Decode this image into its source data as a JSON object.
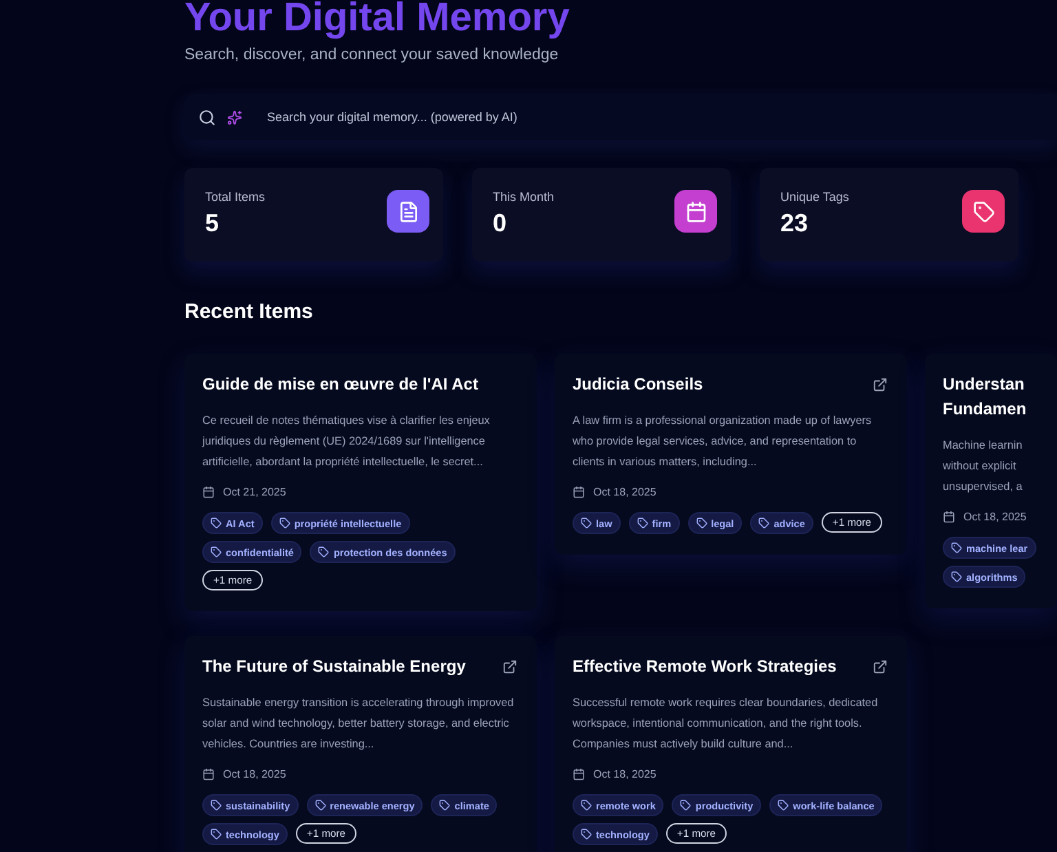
{
  "header": {
    "title": "Your Digital Memory",
    "subtitle": "Search, discover, and connect your saved knowledge"
  },
  "search": {
    "placeholder": "Search your digital memory... (powered by AI)"
  },
  "stats": [
    {
      "label": "Total Items",
      "value": "5",
      "color": "#7b5cf5"
    },
    {
      "label": "This Month",
      "value": "0",
      "color": "#c43fd0"
    },
    {
      "label": "Unique Tags",
      "value": "23",
      "color": "#ea3470"
    }
  ],
  "recent": {
    "heading": "Recent Items",
    "items": [
      {
        "title": "Guide de mise en œuvre de l'AI Act",
        "has_link": false,
        "description": "Ce recueil de notes thématiques vise à clarifier les enjeux juridiques du règlement (UE) 2024/1689 sur l'intelligence artificielle, abordant la propriété intellectuelle, le secret...",
        "date": "Oct 21, 2025",
        "tags": [
          "AI Act",
          "propriété intellectuelle",
          "confidentialité",
          "protection des données"
        ],
        "more": "+1 more"
      },
      {
        "title": "Judicia Conseils",
        "has_link": true,
        "description": "A law firm is a professional organization made up of lawyers who provide legal services, advice, and representation to clients in various matters, including...",
        "date": "Oct 18, 2025",
        "tags": [
          "law",
          "firm",
          "legal",
          "advice"
        ],
        "more": "+1 more"
      },
      {
        "title": "Understan\nFundamen",
        "has_link": false,
        "description": "Machine learnin\nwithout explicit\nunsupervised, a",
        "date": "Oct 18, 2025",
        "tags": [
          "machine lear",
          "algorithms"
        ]
      },
      {
        "title": "The Future of Sustainable Energy",
        "has_link": true,
        "description": "Sustainable energy transition is accelerating through improved solar and wind technology, better battery storage, and electric vehicles. Countries are investing...",
        "date": "Oct 18, 2025",
        "tags": [
          "sustainability",
          "renewable energy",
          "climate",
          "technology"
        ],
        "more": "+1 more"
      },
      {
        "title": "Effective Remote Work Strategies",
        "has_link": true,
        "description": "Successful remote work requires clear boundaries, dedicated workspace, intentional communication, and the right tools. Companies must actively build culture and...",
        "date": "Oct 18, 2025",
        "tags": [
          "remote work",
          "productivity",
          "work-life balance",
          "technology"
        ],
        "more": "+1 more"
      }
    ]
  }
}
